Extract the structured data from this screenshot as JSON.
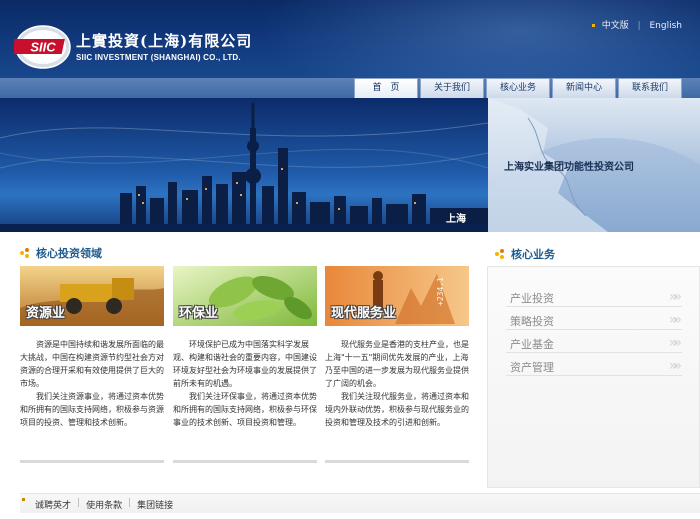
{
  "header": {
    "logo_mark": "SIIC",
    "company_name_cn": "上實投資(上海)有限公司",
    "company_name_en": "SIIC INVESTMENT (SHANGHAI) CO., LTD.",
    "languages": [
      "中文版",
      "English"
    ]
  },
  "nav": {
    "tabs": [
      {
        "label": "首　页",
        "active": true
      },
      {
        "label": "关于我们",
        "active": false
      },
      {
        "label": "核心业务",
        "active": false
      },
      {
        "label": "新闻中心",
        "active": false
      },
      {
        "label": "联系我们",
        "active": false
      }
    ]
  },
  "banner": {
    "city_label": "上海",
    "tagline": "上海实业集团功能性投资公司"
  },
  "main": {
    "section_title": "核心投资领域",
    "sectors": [
      {
        "label": "资源业",
        "paragraphs": [
          "资源是中国持续和谐发展所面临的最大挑战，中国在构建资源节约型社会方对资源的合理开采和有效使用提供了巨大的市场。",
          "我们关注资源事业，将通过资本优势和所拥有的国际支持网络，积极参与资源项目的投资、管理和技术创新。"
        ]
      },
      {
        "label": "环保业",
        "paragraphs": [
          "环境保护已成为中国落实科学发展观、构建和谐社会的重要内容，中国建设环境友好型社会为环境事业的发展提供了前所未有的机遇。",
          "我们关注环保事业，将通过资本优势和所拥有的国际支持网络，积极参与环保事业的技术创新、项目投资和管理。"
        ]
      },
      {
        "label": "现代服务业",
        "paragraphs": [
          "现代服务业是香港的支柱产业，也是上海\"十一五\"期间优先发展的产业，上海乃至中国的进一步发展为现代服务业提供了广阔的机会。",
          "我们关注现代服务业，将通过资本和境内外联动优势，积极参与现代服务业的投资和管理及技术的引进和创新。"
        ]
      }
    ]
  },
  "sidebar": {
    "title": "核心业务",
    "items": [
      "产业投资",
      "策略投资",
      "产业基金",
      "资产管理"
    ]
  },
  "footer": {
    "links": [
      "诚聘英才",
      "使用条款",
      "集团链接"
    ]
  },
  "colors": {
    "header_blue": "#123a7e",
    "accent_title": "#1f5b8f",
    "bullet_orange": "#f2b400"
  }
}
